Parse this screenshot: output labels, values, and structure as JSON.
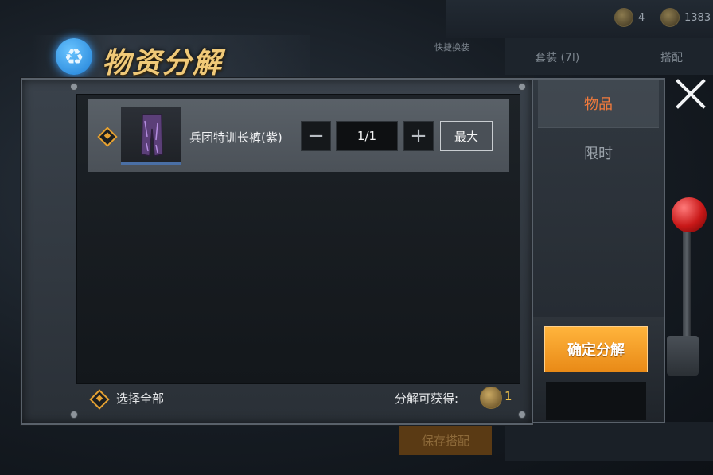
{
  "background": {
    "currencies": [
      {
        "icon": "ticket-coin-icon",
        "value": "4"
      },
      {
        "icon": "gold-coin-icon",
        "value": "1383"
      }
    ],
    "tabs": [
      "套装 (7l)",
      "搭配"
    ],
    "quick_switch": "快捷换装",
    "save_button": "保存搭配"
  },
  "title": "物资分解",
  "item": {
    "name": "兵团特训长裤(紫)",
    "quantity": "1/1",
    "minus": "−",
    "plus": "+",
    "max_label": "最大",
    "selected": true,
    "thumbnail_icon": "purple-pants-icon"
  },
  "footer": {
    "select_all": "选择全部",
    "gain_label": "分解可获得:",
    "gain_value": "1",
    "gain_icon": "gold-coin-icon"
  },
  "side_tabs": [
    {
      "label": "物品",
      "active": true
    },
    {
      "label": "限时",
      "active": false
    }
  ],
  "confirm_label": "确定分解",
  "colors": {
    "accent_orange": "#f17a3c",
    "confirm": "#f5a02a",
    "check": "#e6a233",
    "title_gold": "#f0c978"
  }
}
